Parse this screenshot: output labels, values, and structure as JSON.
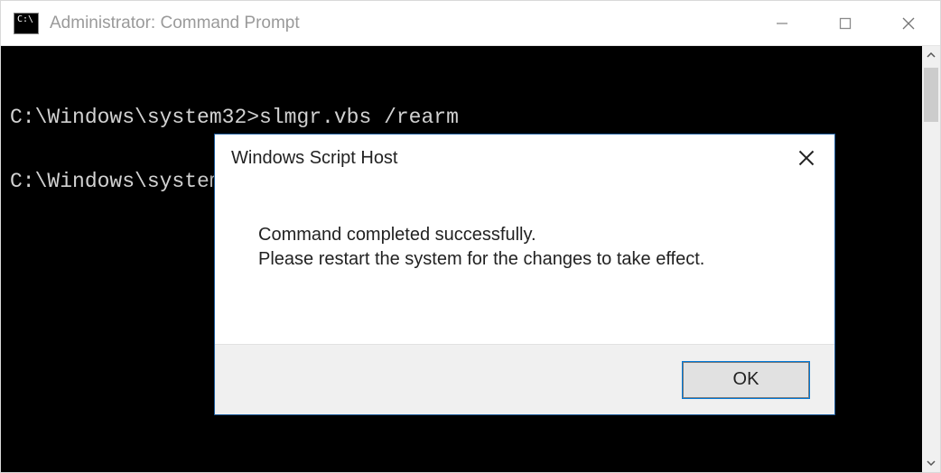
{
  "window": {
    "title": "Administrator: Command Prompt"
  },
  "console": {
    "lines": [
      "C:\\Windows\\system32>slmgr.vbs /rearm",
      "",
      "C:\\Windows\\system32>"
    ]
  },
  "dialog": {
    "title": "Windows Script Host",
    "message_line1": "Command completed successfully.",
    "message_line2": "Please restart the system for the changes to take effect.",
    "ok_label": "OK"
  }
}
